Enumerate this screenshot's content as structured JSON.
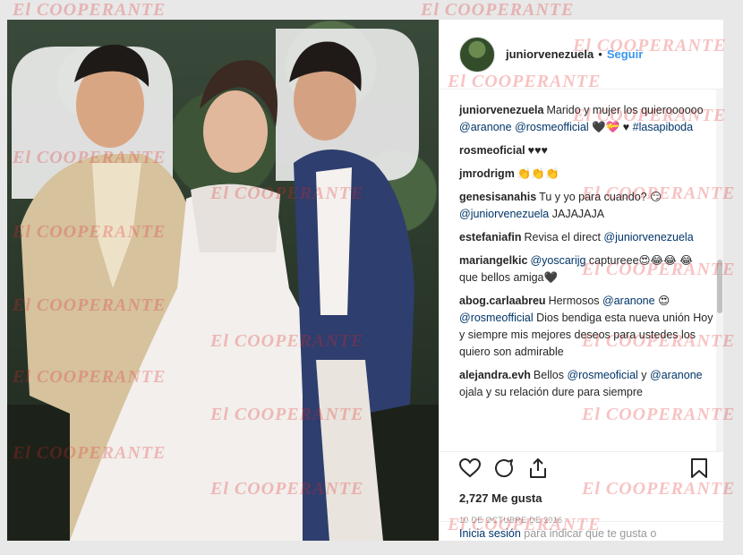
{
  "watermark": "El COOPERANTE",
  "post": {
    "username": "juniorvenezuela",
    "separator": "•",
    "follow_label": "Seguir",
    "likes": "2,727 Me gusta",
    "date": "10 DE OCTUBRE DE 2016",
    "login_link": "Inicia sesión",
    "login_text": " para indicar que te gusta o"
  },
  "comments": [
    {
      "user": "juniorvenezuela",
      "parts": [
        {
          "t": "Marido y mujer los quieroooooo "
        },
        {
          "m": "@aranone"
        },
        {
          "t": " "
        },
        {
          "m": "@rosmeofficial"
        },
        {
          "t": " 🖤💝 ♥ "
        },
        {
          "m": "#lasapiboda"
        }
      ]
    },
    {
      "user": "rosmeoficial",
      "parts": [
        {
          "t": "♥♥♥"
        }
      ]
    },
    {
      "user": "jmrodrigm",
      "parts": [
        {
          "t": "👏👏👏"
        }
      ]
    },
    {
      "user": "genesisanahis",
      "parts": [
        {
          "t": "Tu y yo para cuando? 😏 "
        },
        {
          "m": "@juniorvenezuela"
        },
        {
          "t": " JAJAJAJA"
        }
      ]
    },
    {
      "user": "estefaniafin",
      "parts": [
        {
          "t": "Revisa el direct "
        },
        {
          "m": "@juniorvenezuela"
        }
      ]
    },
    {
      "user": "mariangelkic",
      "parts": [
        {
          "m": "@yoscarijg"
        },
        {
          "t": " captureee😍😂😂 😂 que bellos amiga🖤"
        }
      ]
    },
    {
      "user": "abog.carlaabreu",
      "parts": [
        {
          "t": "Hermosos "
        },
        {
          "m": "@aranone"
        },
        {
          "t": " 😍 "
        },
        {
          "m": "@rosmeofficial"
        },
        {
          "t": " Dios bendiga esta nueva unión Hoy y siempre mis mejores deseos para ustedes los quiero son admirable"
        }
      ]
    },
    {
      "user": "alejandra.evh",
      "parts": [
        {
          "t": "Bellos "
        },
        {
          "m": "@rosmeoficial"
        },
        {
          "t": " y "
        },
        {
          "m": "@aranone"
        },
        {
          "t": " ojala y su relación dure para siempre"
        }
      ]
    }
  ],
  "icons": {
    "like": "heart-icon",
    "comment": "comment-icon",
    "share": "share-icon",
    "save": "bookmark-icon"
  }
}
